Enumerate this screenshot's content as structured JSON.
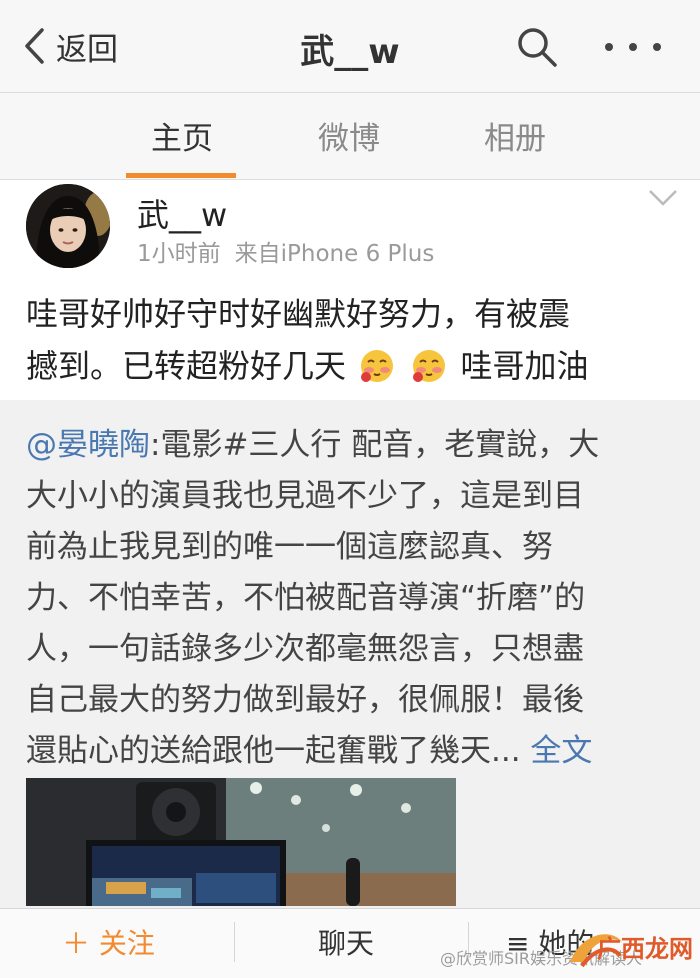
{
  "nav": {
    "back_label": "返回",
    "title": "武__w",
    "search_icon": "search-icon",
    "more_icon": "more-dots-icon"
  },
  "tabs": [
    {
      "label": "主页",
      "active": true
    },
    {
      "label": "微博",
      "active": false
    },
    {
      "label": "相册",
      "active": false
    }
  ],
  "accent_color": "#f28b30",
  "link_color": "#4a78b0",
  "post": {
    "username": "武__w",
    "time": "1小时前",
    "source": "来自iPhone 6 Plus",
    "text_line1": "哇哥好帅好守时好幽默好努力，有被震",
    "text_line2_a": "撼到。已转超粉好几天",
    "text_line2_b": "哇哥加油",
    "emoji_icon": "shy-face-emoji-icon"
  },
  "repost": {
    "mention": "@晏曉陶",
    "line1": ":電影#三人行 配音，老實說，大",
    "line2": "大小小的演員我也見過不少了，這是到目",
    "line3": "前為止我見到的唯一一個這麼認真、努",
    "line4": "力、不怕幸苦，不怕被配音導演“折磨”的",
    "line5": "人，一句話錄多少次都毫無怨言，只想盡",
    "line6": "自己最大的努力做到最好，很佩服！最後",
    "line7": "還貼心的送給跟他一起奮戰了幾天...",
    "full_text_link": "全文"
  },
  "bottom_bar": {
    "follow": "＋ 关注",
    "chat": "聊天",
    "more": "≡ 她的",
    "watermark": "@欣赏师SIR娱乐资讯解读人",
    "logo_text": "广西龙网"
  }
}
